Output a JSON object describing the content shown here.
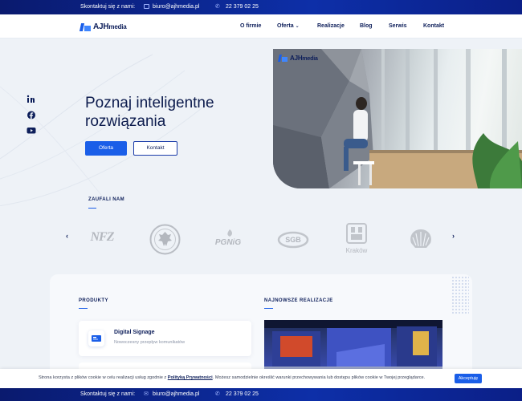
{
  "topbar": {
    "contact_label": "Skontaktuj się z nami:",
    "email": "biuro@ajhmedia.pl",
    "phone": "22 379 02 25"
  },
  "nav": {
    "logo_main": "AJH",
    "logo_suffix": "media",
    "items": [
      {
        "label": "O firmie"
      },
      {
        "label": "Oferta",
        "has_dropdown": true
      },
      {
        "label": "Realizacje"
      },
      {
        "label": "Blog"
      },
      {
        "label": "Serwis"
      },
      {
        "label": "Kontakt"
      }
    ]
  },
  "social": [
    "linkedin-icon",
    "facebook-icon",
    "youtube-icon"
  ],
  "hero": {
    "title_line1": "Poznaj inteligentne",
    "title_line2": "rozwiązania",
    "primary_button": "Oferta",
    "secondary_button": "Kontakt",
    "image_logo_main": "AJH",
    "image_logo_suffix": "media"
  },
  "trusted": {
    "label": "ZAUFALI NAM",
    "prev_arrow": "‹",
    "next_arrow": "›",
    "clients": [
      {
        "name": "NFZ"
      },
      {
        "name": "emblem"
      },
      {
        "name": "PGNiG"
      },
      {
        "name": "SGB"
      },
      {
        "name": "Kraków"
      },
      {
        "name": "shell-logo"
      }
    ]
  },
  "products": {
    "label": "PRODUKTY",
    "items": [
      {
        "title": "Digital Signage",
        "subtitle": "Nowoczesny przepływ komunikatów"
      }
    ]
  },
  "realizations": {
    "label": "NAJNOWSZE REALIZACJE"
  },
  "cookie": {
    "text_before": "Strona korzysta z plików cookie w celu realizacji usług zgodnie z ",
    "link": "Polityką Prywatności",
    "text_after": ". Możesz samodzielnie określić warunki przechowywania lub dostępu plików cookie w Twojej przeglądarce.",
    "accept_button": "Akceptuję"
  },
  "bottombar": {
    "contact_label": "Skontaktuj się z nami:",
    "email": "biuro@ajhmedia.pl",
    "phone": "22 379 02 25"
  },
  "colors": {
    "brand_dark": "#0d1e5a",
    "brand_blue": "#1a5ee8",
    "bar_gradient_start": "#0a1a6e",
    "bar_gradient_end": "#0d2fa8"
  }
}
